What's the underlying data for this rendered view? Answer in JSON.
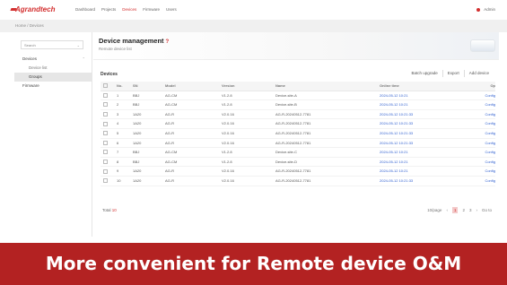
{
  "app": {
    "logo_text": "Agrandtech",
    "nav_items": [
      "Dashboard",
      "Projects",
      "Devices",
      "Firmware",
      "Users"
    ],
    "active_nav_index": 2,
    "user_label": "Admin",
    "accent_color": "#d32f2f"
  },
  "breadcrumb": "Home / Devices",
  "sidebar": {
    "search_placeholder": "Search",
    "items": [
      {
        "label": "Devices",
        "sub": false,
        "active": false,
        "chevron": "⌃"
      },
      {
        "label": "Device list",
        "sub": true,
        "active": false
      },
      {
        "label": "Groups",
        "sub": true,
        "active": true
      },
      {
        "label": "Firmware",
        "sub": false,
        "active": false
      }
    ]
  },
  "main": {
    "title": "Device management",
    "help_icon": "?",
    "subtitle": "Remote device list",
    "toolbar_label": "Devices",
    "toolbar_buttons": [
      "Batch upgrade",
      "Export",
      "Add device"
    ]
  },
  "table": {
    "headers": [
      "No.",
      "SN",
      "Model",
      "Version",
      "Name",
      "Online time",
      "Op"
    ],
    "rows": [
      {
        "no": "1",
        "sn": "BBJ",
        "model": "AG-CM",
        "version": "V1.2.8",
        "name": "Device-site-A",
        "online": "2024-05-12 10:21",
        "op": "Config"
      },
      {
        "no": "2",
        "sn": "BBJ",
        "model": "AG-CM",
        "version": "V1.2.8",
        "name": "Device-site-B",
        "online": "2024-05-12 10:21",
        "op": "Config"
      },
      {
        "no": "3",
        "sn": "1A20",
        "model": "AG-R",
        "version": "V2.0.16",
        "name": "AG-R-20240512-7781",
        "online": "2024-05-12 10:21:33",
        "op": "Config"
      },
      {
        "no": "4",
        "sn": "1A20",
        "model": "AG-R",
        "version": "V2.0.16",
        "name": "AG-R-20240512-7781",
        "online": "2024-05-12 10:21:33",
        "op": "Config"
      },
      {
        "no": "5",
        "sn": "1A20",
        "model": "AG-R",
        "version": "V2.0.16",
        "name": "AG-R-20240512-7781",
        "online": "2024-05-12 10:21:33",
        "op": "Config"
      },
      {
        "no": "6",
        "sn": "1A20",
        "model": "AG-R",
        "version": "V2.0.16",
        "name": "AG-R-20240512-7781",
        "online": "2024-05-12 10:21:33",
        "op": "Config"
      },
      {
        "no": "7",
        "sn": "BBJ",
        "model": "AG-CM",
        "version": "V1.2.8",
        "name": "Device-site-C",
        "online": "2024-05-12 10:21",
        "op": "Config"
      },
      {
        "no": "8",
        "sn": "BBJ",
        "model": "AG-CM",
        "version": "V1.2.8",
        "name": "Device-site-D",
        "online": "2024-05-12 10:21",
        "op": "Config"
      },
      {
        "no": "9",
        "sn": "1A20",
        "model": "AG-R",
        "version": "V2.0.16",
        "name": "AG-R-20240512-7781",
        "online": "2024-05-12 10:21",
        "op": "Config"
      },
      {
        "no": "10",
        "sn": "1A20",
        "model": "AG-R",
        "version": "V2.0.16",
        "name": "AG-R-20240512-7781",
        "online": "2024-05-12 10:21:33",
        "op": "Config"
      }
    ]
  },
  "footer": {
    "total_label": "Total",
    "total_count": "10",
    "pager": {
      "per_page": "10/page",
      "prev": "‹",
      "pages": [
        "1",
        "2",
        "3"
      ],
      "current": "1",
      "next": "›",
      "goto_label": "Go to"
    }
  },
  "banner": {
    "text": "More convenient for Remote device O&M",
    "color": "#b32222"
  }
}
